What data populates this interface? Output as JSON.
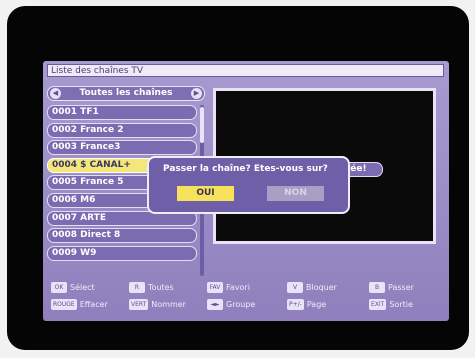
{
  "window": {
    "title": "Liste des chaînes TV"
  },
  "group_selector": {
    "label": "Toutes les chaînes",
    "prev_icon": "chevron-left-icon",
    "next_icon": "chevron-right-icon"
  },
  "channels": [
    {
      "label": "0001  TF1",
      "selected": false
    },
    {
      "label": "0002  France 2",
      "selected": false
    },
    {
      "label": "0003  France3",
      "selected": false
    },
    {
      "label": "0004  $ CANAL+",
      "selected": true
    },
    {
      "label": "0005  France 5",
      "selected": false
    },
    {
      "label": "0006  M6",
      "selected": false
    },
    {
      "label": "0007  ARTE",
      "selected": false
    },
    {
      "label": "0008  Direct 8",
      "selected": false
    },
    {
      "label": "0009  W9",
      "selected": false
    }
  ],
  "preview_info": {
    "label": "tée!"
  },
  "dialog": {
    "message": "Passer la chaîne? Etes-vous sur?",
    "yes_label": "OUI",
    "no_label": "NON"
  },
  "footer": {
    "row1": [
      {
        "key": "OK",
        "label": "Sélect"
      },
      {
        "key": "R",
        "label": "Toutes"
      },
      {
        "key": "FAV",
        "label": "Favori"
      },
      {
        "key": "V",
        "label": "Bloquer"
      },
      {
        "key": "B",
        "label": "Passer"
      }
    ],
    "row2": [
      {
        "key": "ROUGE",
        "label": "Effacer"
      },
      {
        "key": "VERT",
        "label": "Nommer"
      },
      {
        "key": "◄►",
        "label": "Groupe"
      },
      {
        "key": "P+/-",
        "label": "Page"
      },
      {
        "key": "EXIT",
        "label": "Sortie"
      }
    ]
  },
  "colors": {
    "panel": "#9a8bc4",
    "item": "#7b6bb0",
    "selected_item": "#f4e77a",
    "dialog": "#6e5fa8",
    "yes_button": "#f5e25a"
  }
}
